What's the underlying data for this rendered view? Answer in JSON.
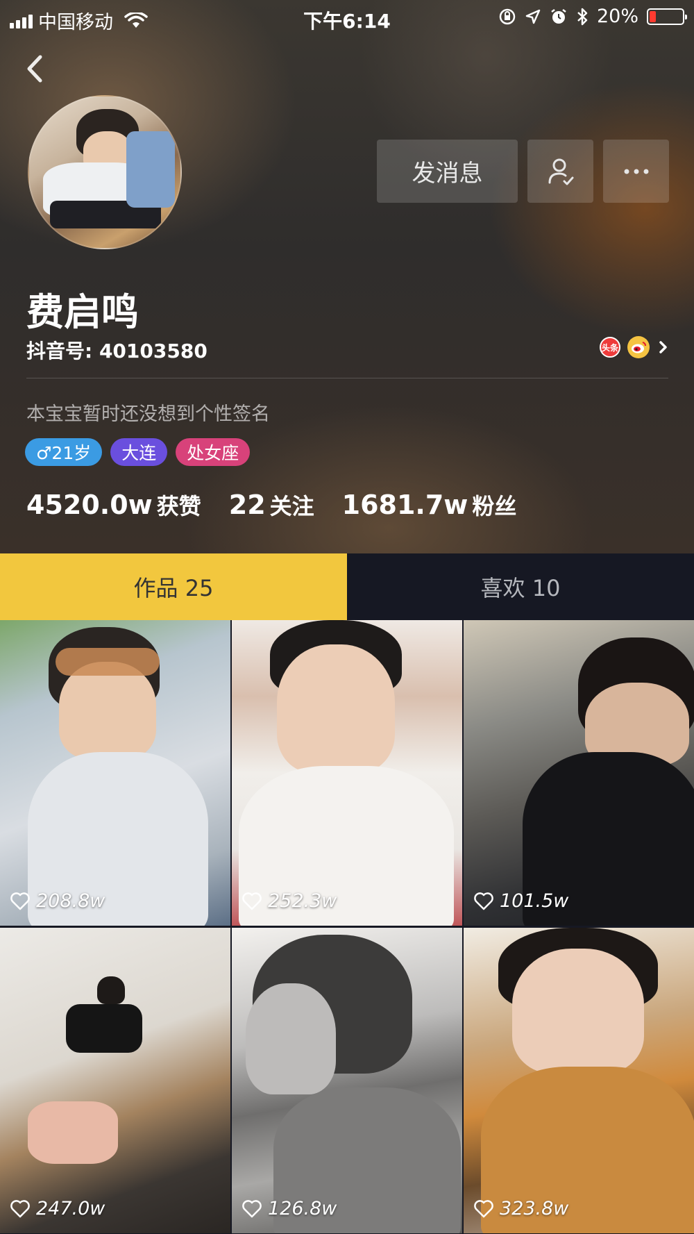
{
  "status_bar": {
    "carrier": "中国移动",
    "time": "下午6:14",
    "battery_percent": "20%",
    "battery_level": 0.2
  },
  "profile": {
    "name": "费启鸣",
    "douyin_id": "抖音号: 40103580",
    "signature": "本宝宝暂时还没想到个性签名",
    "toutiao_label": "头条",
    "tags": {
      "age": "♂21岁",
      "city": "大连",
      "zodiac": "处女座"
    },
    "stats": {
      "likes_value": "4520.0w",
      "likes_label": "获赞",
      "following_value": "22",
      "following_label": "关注",
      "followers_value": "1681.7w",
      "followers_label": "粉丝"
    }
  },
  "actions": {
    "message_label": "发消息"
  },
  "tabs": {
    "works_label": "作品 25",
    "likes_label": "喜欢 10"
  },
  "videos": [
    {
      "likes": "208.8w"
    },
    {
      "likes": "252.3w"
    },
    {
      "likes": "101.5w"
    },
    {
      "likes": "247.0w"
    },
    {
      "likes": "126.8w"
    },
    {
      "likes": "323.8w"
    }
  ],
  "colors": {
    "tab_active": "#f2c73e",
    "background": "#161823",
    "tag_age": "#3b9be3",
    "tag_city": "#6a4fde",
    "tag_zodiac": "#d8427a"
  }
}
